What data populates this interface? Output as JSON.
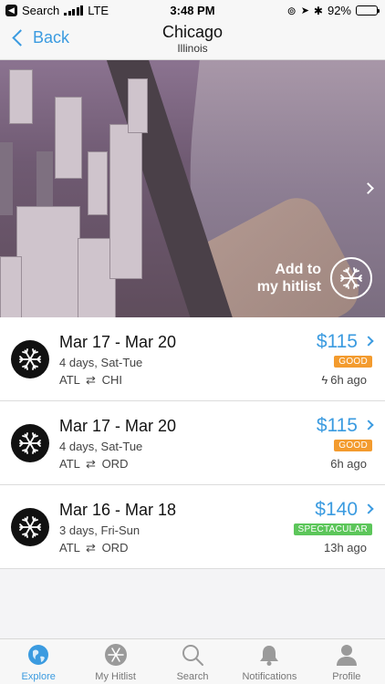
{
  "status_bar": {
    "carrier_app": "Search",
    "network": "LTE",
    "time": "3:48 PM",
    "battery": "92%",
    "battery_level": 0.92
  },
  "nav": {
    "back_label": "Back",
    "title": "Chicago",
    "subtitle": "Illinois"
  },
  "hero": {
    "add_hitlist_line1": "Add to",
    "add_hitlist_line2": "my hitlist",
    "icon": "snowflake-plane-icon"
  },
  "deals": [
    {
      "dates": "Mar 17 - Mar 20",
      "days": "4 days, Sat-Tue",
      "origin": "ATL",
      "destination": "CHI",
      "price": "$115",
      "badge": "GOOD",
      "badge_color": "#f39b2e",
      "ago": "6h ago",
      "flash": true
    },
    {
      "dates": "Mar 17 - Mar 20",
      "days": "4 days, Sat-Tue",
      "origin": "ATL",
      "destination": "ORD",
      "price": "$115",
      "badge": "GOOD",
      "badge_color": "#f39b2e",
      "ago": "6h ago",
      "flash": false
    },
    {
      "dates": "Mar 16 - Mar 18",
      "days": "3 days, Fri-Sun",
      "origin": "ATL",
      "destination": "ORD",
      "price": "$140",
      "badge": "SPECTACULAR",
      "badge_color": "#5cc65a",
      "ago": "13h ago",
      "flash": false
    }
  ],
  "tabs": [
    {
      "label": "Explore",
      "icon": "globe-icon",
      "active": true
    },
    {
      "label": "My Hitlist",
      "icon": "snowflake-badge-icon",
      "active": false
    },
    {
      "label": "Search",
      "icon": "magnifier-icon",
      "active": false
    },
    {
      "label": "Notifications",
      "icon": "bell-icon",
      "active": false
    },
    {
      "label": "Profile",
      "icon": "person-icon",
      "active": false
    }
  ],
  "colors": {
    "accent": "#3b9be0",
    "good": "#f39b2e",
    "spectacular": "#5cc65a"
  }
}
